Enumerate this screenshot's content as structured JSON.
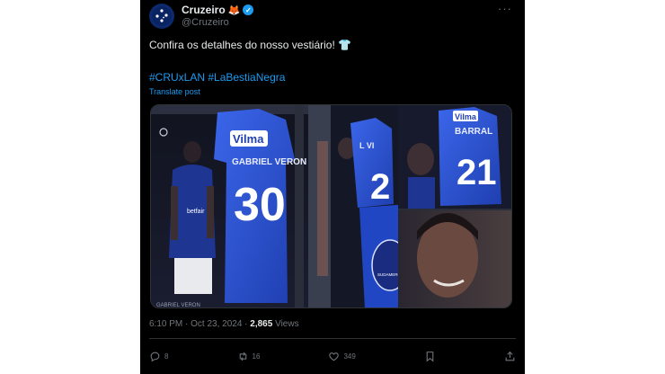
{
  "author": {
    "name": "Cruzeiro",
    "emoji": "🦊",
    "handle": "@Cruzeiro",
    "verified": true
  },
  "post": {
    "text": "Confira os detalhes do nosso vestiário!",
    "emoji": "👕",
    "hashtags": [
      "#CRUxLAN",
      "#LaBestiaNegra"
    ],
    "translate_label": "Translate post"
  },
  "media": {
    "jersey_sponsor": "Vilma",
    "left_jersey_name": "GABRIEL VERON",
    "left_jersey_number": "30",
    "mid_jersey_name": "L VI",
    "mid_jersey_number": "2",
    "right_jersey_name": "BARRAL",
    "right_jersey_number": "21",
    "chest_sponsor": "betfair",
    "patch_text": "SUDAMERICANA",
    "bench_tag": "GABRIEL VERON"
  },
  "meta": {
    "time": "6:10 PM · Oct 23, 2024 · ",
    "views_count": "2,865",
    "views_label": " Views"
  },
  "actions": {
    "replies": "8",
    "reposts": "16",
    "likes": "349"
  },
  "colors": {
    "accent": "#1d9bf0",
    "background": "#000000",
    "jersey_blue": "#2f58d8"
  }
}
